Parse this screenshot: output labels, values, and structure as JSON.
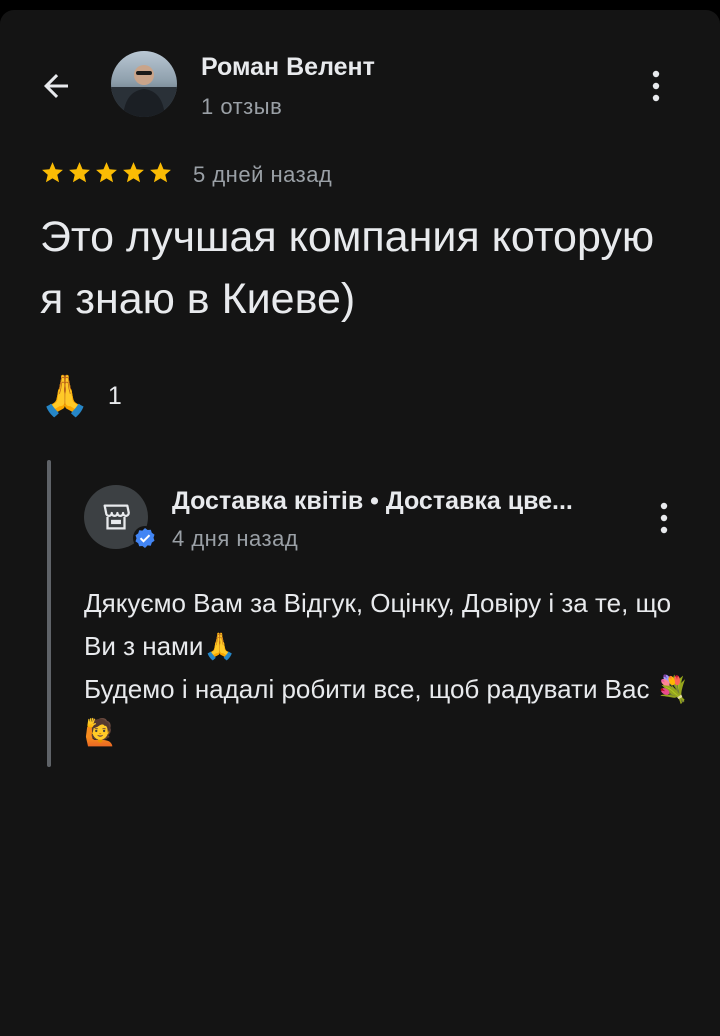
{
  "header": {
    "back_icon": "arrow-back-icon",
    "author_name": "Роман Велент",
    "author_reviews": "1 отзыв",
    "more_icon": "more-vert-icon"
  },
  "review": {
    "rating": 5,
    "rating_max": 5,
    "star_color": "#fbbc04",
    "date": "5 дней назад",
    "text": "Это лучшая компания которую я знаю в Киеве)",
    "reaction_emoji": "🙏",
    "reaction_count": "1"
  },
  "owner_reply": {
    "name": "Доставка квітів • Доставка цве...",
    "date": "4 дня назад",
    "avatar_icon": "storefront-icon",
    "verified_icon": "verified-badge-icon",
    "verified_color": "#4285f4",
    "text": "Дякуємо Вам за Відгук, Оцінку, Довіру і за те, що Ви з нами🙏\nБудемо і надалі робити все, щоб радувати Вас 💐🙋"
  }
}
